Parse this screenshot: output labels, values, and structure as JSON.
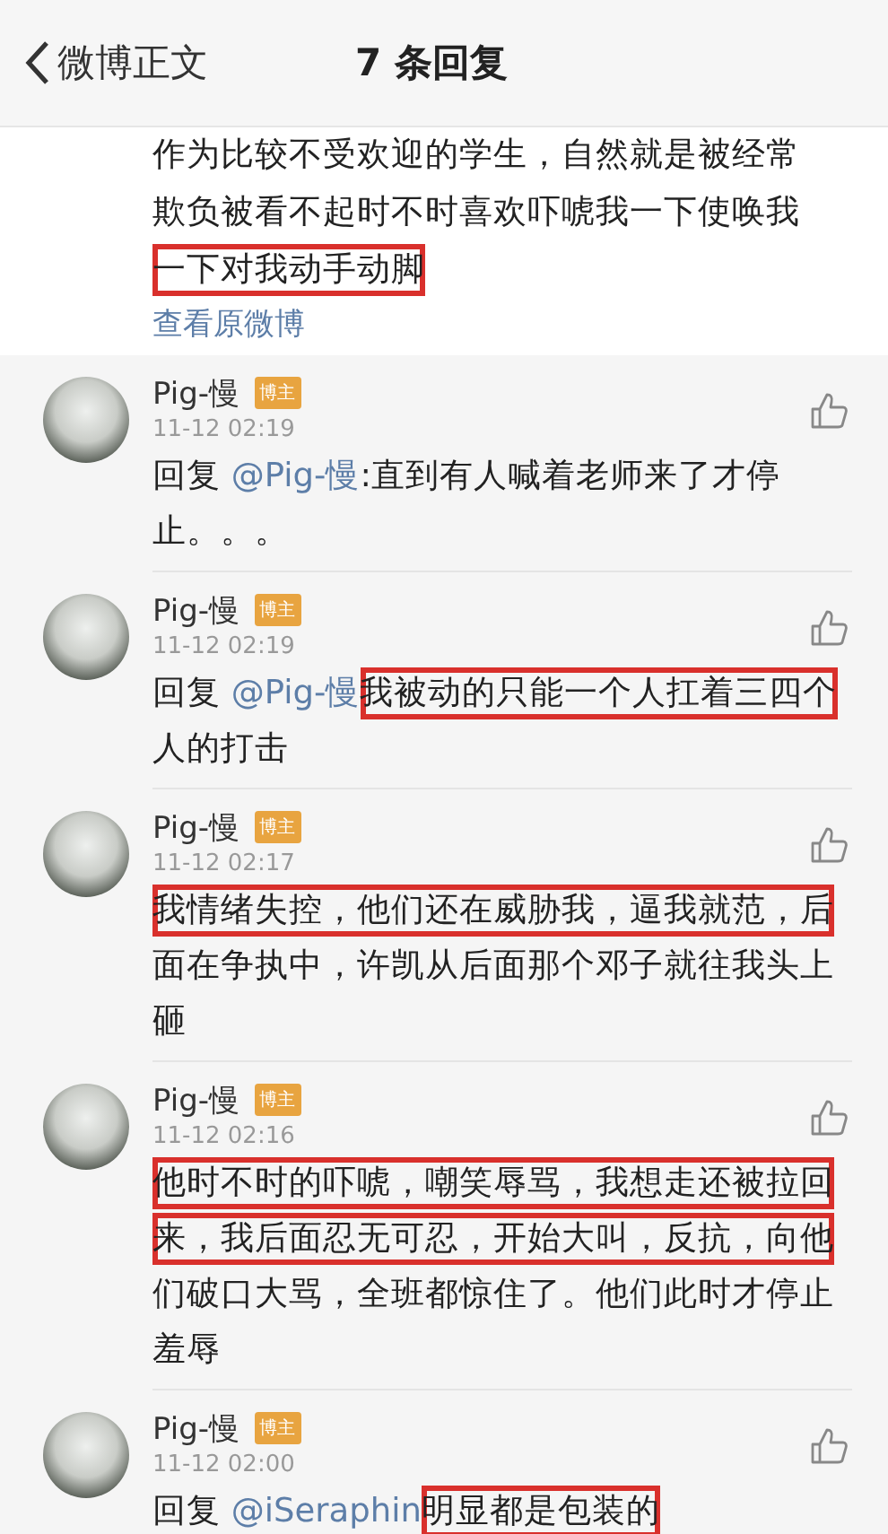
{
  "header": {
    "back_label": "微博正文",
    "title": "7 条回复"
  },
  "post": {
    "lines": [
      {
        "text": "作为比较不受欢迎的学生，自然就是被经常",
        "highlighted": false
      },
      {
        "text": "欺负被看不起时不时喜欢吓唬我一下使唤我",
        "highlighted": false
      },
      {
        "text": "一下对我动手动脚",
        "highlighted": true
      }
    ],
    "link": "查看原微博"
  },
  "comments": [
    {
      "author": "Pig-慢",
      "badge": "博主",
      "time": "11-12 02:19",
      "body": [
        {
          "kind": "text",
          "text": "回复 ",
          "highlighted": false
        },
        {
          "kind": "mention",
          "text": "@Pig-慢",
          "highlighted": false
        },
        {
          "kind": "text",
          "text": ":直到有人喊着老师来了才停止。。。",
          "highlighted": false
        }
      ]
    },
    {
      "author": "Pig-慢",
      "badge": "博主",
      "time": "11-12 02:19",
      "body": [
        {
          "kind": "text",
          "text": "回复 ",
          "highlighted": false
        },
        {
          "kind": "mention",
          "text": "@Pig-慢",
          "highlighted": false
        },
        {
          "kind": "text",
          "text": "我被动的只能一个人扛着三四个",
          "highlighted": true
        },
        {
          "kind": "text",
          "text": "人的打击",
          "highlighted": false
        }
      ]
    },
    {
      "author": "Pig-慢",
      "badge": "博主",
      "time": "11-12 02:17",
      "body": [
        {
          "kind": "text",
          "text": "我情绪失控，他们还在威胁我，逼我就范，后",
          "highlighted": true
        },
        {
          "kind": "text",
          "text": "面在争执中，许凯从后面那个邓子就往我头上砸",
          "highlighted": false
        }
      ]
    },
    {
      "author": "Pig-慢",
      "badge": "博主",
      "time": "11-12 02:16",
      "body": [
        {
          "kind": "text",
          "text": "他时不时的吓唬，嘲笑辱骂，我想走还被拉回来，我后面忍无可忍，开始大叫，反抗，向他",
          "highlighted": true
        },
        {
          "kind": "text",
          "text": "们破口大骂，全班都惊住了。他们此时才停止羞辱",
          "highlighted": false
        }
      ]
    },
    {
      "author": "Pig-慢",
      "badge": "博主",
      "time": "11-12 02:00",
      "body": [
        {
          "kind": "text",
          "text": "回复 ",
          "highlighted": false
        },
        {
          "kind": "mention",
          "text": "@iSeraphin",
          "highlighted": false
        },
        {
          "kind": "text",
          "text": "明显都是包装的",
          "highlighted": true
        }
      ]
    }
  ]
}
